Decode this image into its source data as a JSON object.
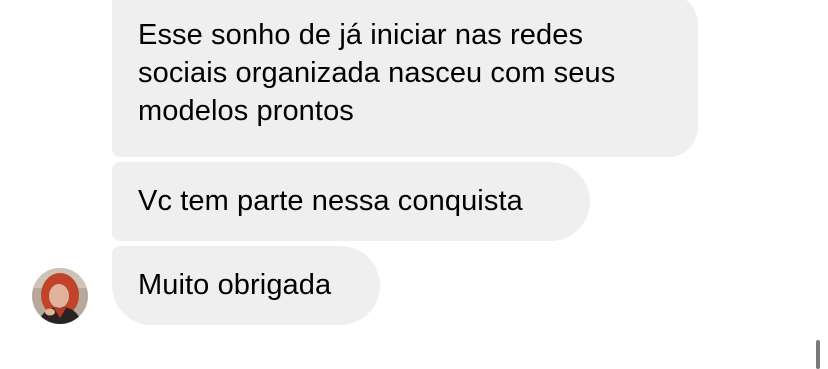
{
  "conversation": {
    "messages": [
      {
        "lines": [
          "Esse sonho de já iniciar nas redes",
          "sociais organizada nasceu com seus",
          "modelos prontos"
        ]
      },
      {
        "lines": [
          "Vc tem parte nessa conquista"
        ]
      },
      {
        "lines": [
          "Muito obrigada"
        ]
      }
    ],
    "bubble_color": "#efefef",
    "text_color": "#000000"
  },
  "sender": {
    "avatar_icon": "profile-photo-avatar"
  },
  "scrollbar": {
    "color": "#7a7a7a"
  }
}
